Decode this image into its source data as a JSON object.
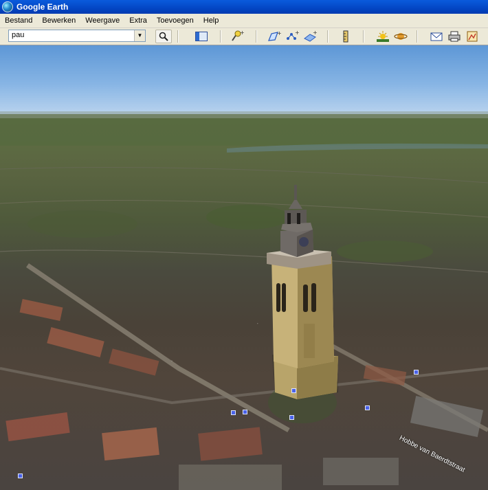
{
  "window": {
    "title": "Google Earth"
  },
  "menu": [
    "Bestand",
    "Bewerken",
    "Weergave",
    "Extra",
    "Toevoegen",
    "Help"
  ],
  "toolbar": {
    "search_value": "pau",
    "icons": [
      "search-icon",
      "sidebar-toggle-icon",
      "placemark-icon",
      "polygon-icon",
      "path-icon",
      "image-overlay-icon",
      "ruler-icon",
      "sunlight-icon",
      "planet-icon",
      "email-icon",
      "print-icon",
      "map-view-icon"
    ]
  },
  "map": {
    "street_label": "Hobbe van Baerdtstraat"
  }
}
